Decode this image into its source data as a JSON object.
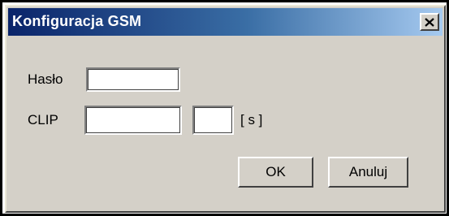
{
  "window": {
    "title": "Konfiguracja GSM",
    "close_glyph": "✕",
    "close_icon": "close-icon"
  },
  "form": {
    "password_label": "Hasło",
    "password_value": "",
    "clip_label": "CLIP",
    "clip_value": "",
    "seconds_value": "",
    "seconds_unit": "[ s ]"
  },
  "buttons": {
    "ok_label": "OK",
    "cancel_label": "Anuluj"
  },
  "colors": {
    "titlebar_start": "#0a246a",
    "titlebar_end": "#a6caf0",
    "face": "#d4d0c8"
  }
}
